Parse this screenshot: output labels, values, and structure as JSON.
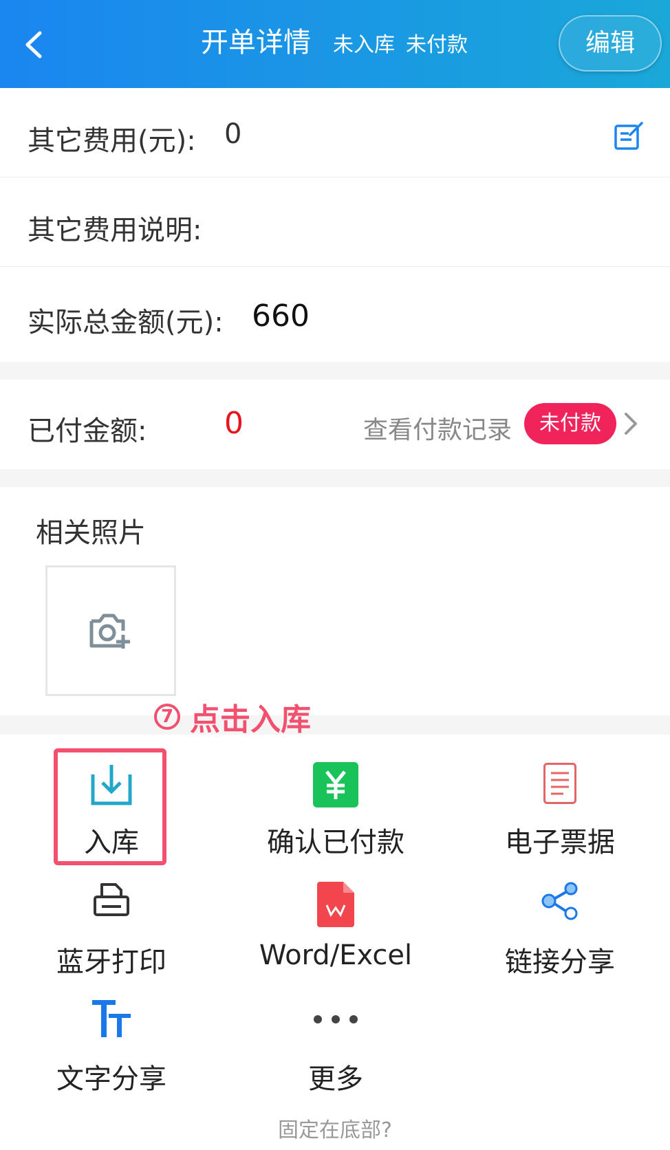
{
  "header": {
    "title": "开单详情",
    "status_stock": "未入库",
    "status_payment": "未付款",
    "edit_label": "编辑"
  },
  "fields": {
    "other_fee_label": "其它费用(元):",
    "other_fee_value": "0",
    "other_fee_desc_label": "其它费用说明:",
    "total_label": "实际总金额(元):",
    "total_value": "660"
  },
  "payment": {
    "paid_label": "已付金额:",
    "paid_value": "0",
    "view_records": "查看付款记录",
    "badge": "未付款"
  },
  "photos": {
    "label": "相关照片"
  },
  "annotation": {
    "number": "7",
    "text": "点击入库"
  },
  "actions": [
    {
      "label": "入库",
      "icon": "stock-in-icon"
    },
    {
      "label": "确认已付款",
      "icon": "yuan-icon"
    },
    {
      "label": "电子票据",
      "icon": "receipt-icon"
    },
    {
      "label": "蓝牙打印",
      "icon": "printer-icon"
    },
    {
      "label": "Word/Excel",
      "icon": "wps-icon"
    },
    {
      "label": "链接分享",
      "icon": "share-icon"
    },
    {
      "label": "文字分享",
      "icon": "text-icon"
    },
    {
      "label": "更多",
      "icon": "more-icon"
    }
  ],
  "footer": {
    "pin_bottom": "固定在底部?"
  },
  "colors": {
    "header_start": "#1a86f0",
    "header_end": "#1aa8d8",
    "accent_red": "#f0245a",
    "annotation": "#f2506e",
    "paid_value": "#e8141e"
  }
}
